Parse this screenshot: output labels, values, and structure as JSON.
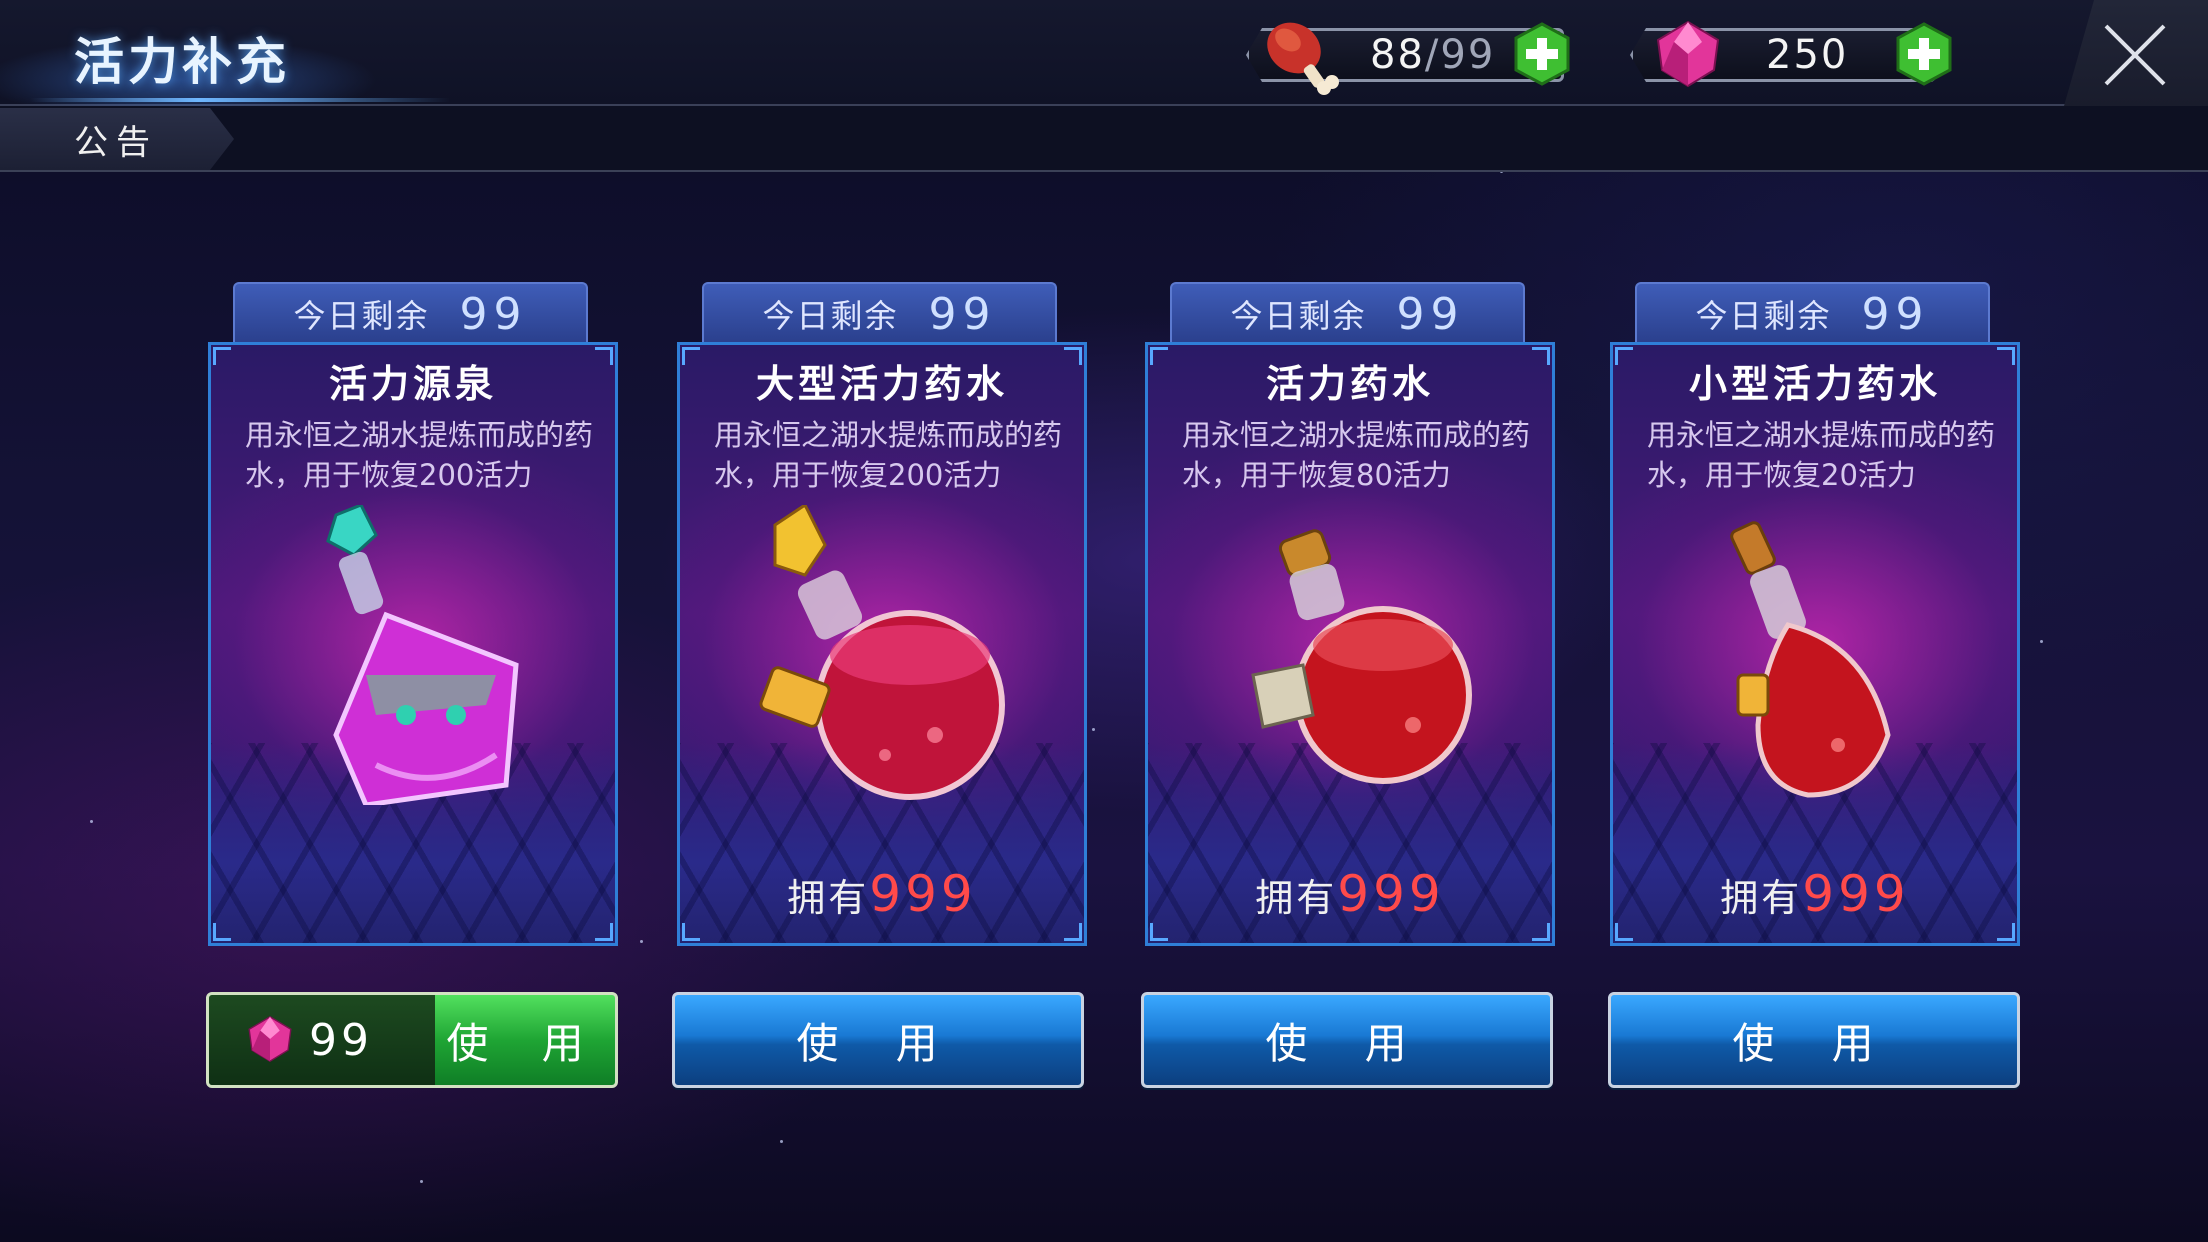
{
  "header": {
    "title": "活力补充",
    "notice_tab": "公告"
  },
  "resources": {
    "stamina": {
      "icon": "meat-drumstick-icon",
      "current": "88",
      "max": "/99"
    },
    "gems": {
      "icon": "pink-gem-icon",
      "value": "250"
    }
  },
  "cards": [
    {
      "remain_label": "今日剩余",
      "remain": "99",
      "name": "活力源泉",
      "desc": "用永恒之湖水提炼而成的药水，用于恢复200活力",
      "potion_icon": "crystal-flask-icon",
      "owned_label": "",
      "owned": ""
    },
    {
      "remain_label": "今日剩余",
      "remain": "99",
      "name": "大型活力药水",
      "desc": "用永恒之湖水提炼而成的药水，用于恢复200活力",
      "potion_icon": "large-potion-icon",
      "owned_label": "拥有",
      "owned": "999"
    },
    {
      "remain_label": "今日剩余",
      "remain": "99",
      "name": "活力药水",
      "desc": "用永恒之湖水提炼而成的药水，用于恢复80活力",
      "potion_icon": "medium-potion-icon",
      "owned_label": "拥有",
      "owned": "999"
    },
    {
      "remain_label": "今日剩余",
      "remain": "99",
      "name": "小型活力药水",
      "desc": "用永恒之湖水提炼而成的药水，用于恢复20活力",
      "potion_icon": "small-potion-icon",
      "owned_label": "拥有",
      "owned": "999"
    }
  ],
  "buttons": {
    "gem_cost": "99",
    "use_label": "使 用"
  },
  "colors": {
    "accent_blue": "#1979d4",
    "accent_green": "#1fa534",
    "owned_red": "#ff4a4a",
    "card_border": "#2f7fd8"
  }
}
